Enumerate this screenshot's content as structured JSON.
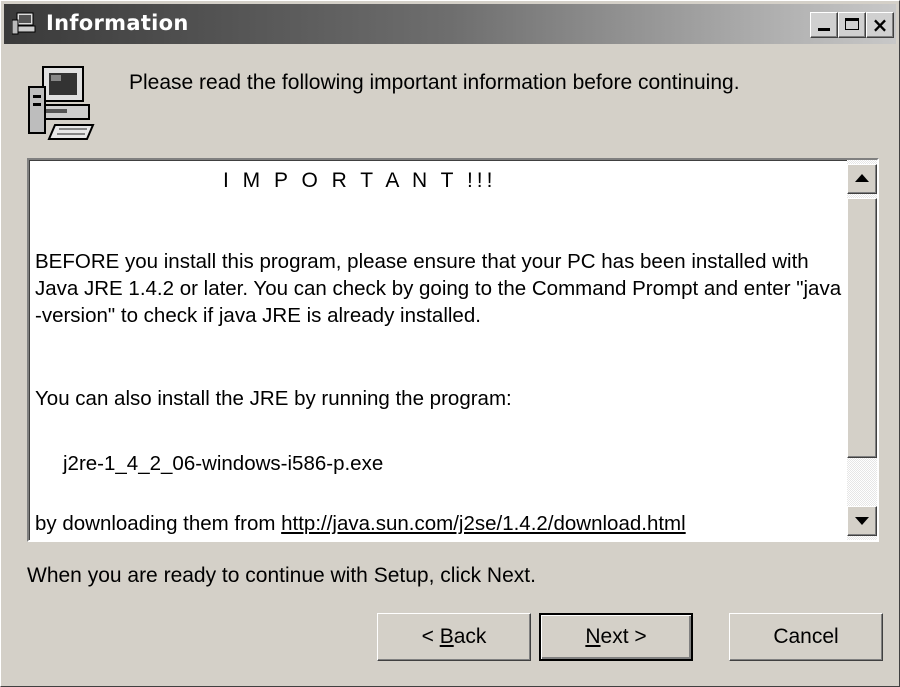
{
  "window": {
    "title": "Information",
    "controls": {
      "minimize": "minimize",
      "maximize": "maximize",
      "close": "×"
    }
  },
  "header": {
    "text": "Please read the following important information before continuing.",
    "icon": "computer-setup-icon"
  },
  "info_box": {
    "heading": "I M P O R T A N T !!!",
    "paragraph1": "BEFORE you install this program, please ensure that your PC has been installed with Java JRE 1.4.2 or later. You can check by going to the Command Prompt and enter \"java -version\" to check if java JRE is already installed.",
    "paragraph2": "You can also install the JRE by running the program:",
    "filename": "j2re-1_4_2_06-windows-i586-p.exe",
    "paragraph3_prefix": "by downloading them from ",
    "link": "http://java.sun.com/j2se/1.4.2/download.html"
  },
  "footer": {
    "text": "When you are ready to continue with Setup, click Next."
  },
  "buttons": {
    "back_prefix": "< ",
    "back_accel": "B",
    "back_rest": "ack",
    "next_accel": "N",
    "next_rest": "ext >",
    "cancel": "Cancel"
  }
}
